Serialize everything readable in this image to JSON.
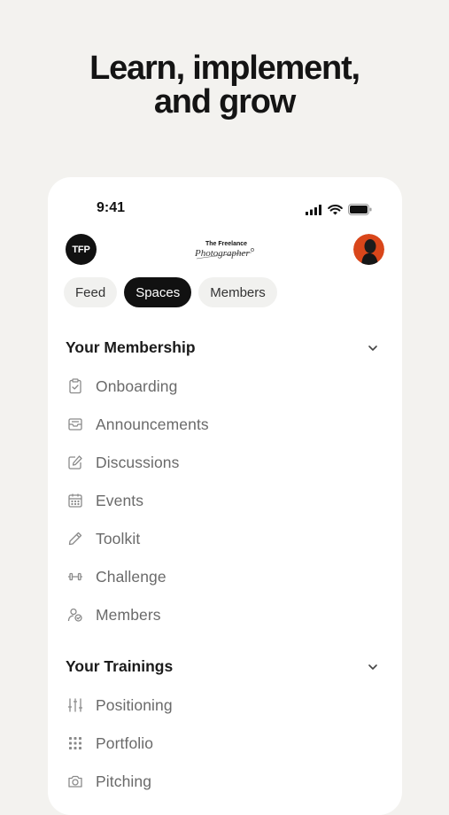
{
  "headline": {
    "line1": "Learn, implement,",
    "line2": "and grow"
  },
  "status_bar": {
    "time": "9:41"
  },
  "header": {
    "brand_badge": "TFP",
    "logo_text_top": "The Freelance",
    "logo_text_script": "Photographer"
  },
  "tabs": [
    {
      "label": "Feed",
      "active": false
    },
    {
      "label": "Spaces",
      "active": true
    },
    {
      "label": "Members",
      "active": false
    }
  ],
  "membership": {
    "title": "Your Membership",
    "items": [
      {
        "label": "Onboarding",
        "icon": "clipboard-check-icon"
      },
      {
        "label": "Announcements",
        "icon": "inbox-icon"
      },
      {
        "label": "Discussions",
        "icon": "edit-icon"
      },
      {
        "label": "Events",
        "icon": "calendar-icon"
      },
      {
        "label": "Toolkit",
        "icon": "pen-icon"
      },
      {
        "label": "Challenge",
        "icon": "dumbbell-icon"
      },
      {
        "label": "Members",
        "icon": "users-icon"
      }
    ]
  },
  "trainings": {
    "title": "Your Trainings",
    "items": [
      {
        "label": "Positioning",
        "icon": "sliders-icon"
      },
      {
        "label": "Portfolio",
        "icon": "grid-icon"
      },
      {
        "label": "Pitching",
        "icon": "camera-icon"
      }
    ]
  },
  "colors": {
    "background": "#f3f2ef",
    "card": "#ffffff",
    "active_tab": "#111111",
    "inactive_tab": "#f1f1ef",
    "item_text": "#6a6a6a"
  }
}
